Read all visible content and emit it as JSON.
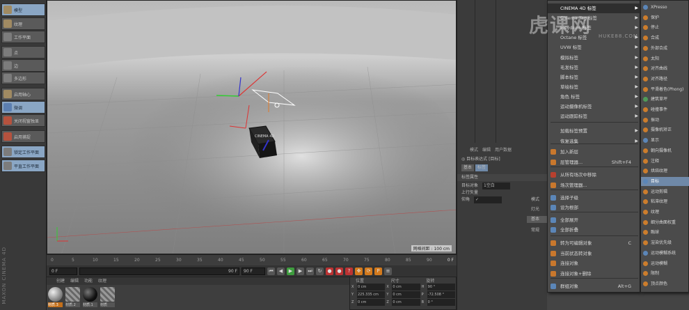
{
  "app": {
    "watermark": "虎课网",
    "watermark_url": "HUKE88.COM",
    "brand": "MAXON CINEMA 4D"
  },
  "toolbar": [
    {
      "label": "模型",
      "sel": true,
      "icon": "model-icon"
    },
    {
      "label": "纹理",
      "sel": false,
      "icon": "texture-icon"
    },
    {
      "label": "工作平面",
      "sel": false,
      "icon": "workplane-icon"
    },
    {
      "label": "点",
      "sel": false,
      "icon": "point-icon"
    },
    {
      "label": "边",
      "sel": false,
      "icon": "edge-icon"
    },
    {
      "label": "多边形",
      "sel": false,
      "icon": "polygon-icon"
    },
    {
      "label": "启用轴心",
      "sel": false,
      "icon": "axis-icon"
    },
    {
      "label": "微调",
      "sel": true,
      "icon": "tweak-icon"
    },
    {
      "label": "关闭视窗独显",
      "sel": false,
      "icon": "solo-icon"
    },
    {
      "label": "启用捕捉",
      "sel": false,
      "icon": "snap-icon"
    },
    {
      "label": "锁定工作平面",
      "sel": true,
      "icon": "lock-icon"
    },
    {
      "label": "平直工作平面",
      "sel": true,
      "icon": "plane-icon"
    }
  ],
  "viewport": {
    "status": "网格间距 : 100 cm",
    "cube_label": "CINEMA 4D"
  },
  "timeline": {
    "frames": [
      "0",
      "5",
      "10",
      "15",
      "20",
      "25",
      "30",
      "35",
      "40",
      "45",
      "50",
      "55",
      "60",
      "65",
      "70",
      "75",
      "80",
      "85",
      "90"
    ],
    "end": "0 F"
  },
  "playbar": {
    "start": "0 F",
    "range": "90 F",
    "end": "90 F"
  },
  "materials": {
    "tabs": [
      "创建",
      "编辑",
      "功能",
      "纹理"
    ],
    "items": [
      {
        "label": "材质.3",
        "sel": true
      },
      {
        "label": "材质.2",
        "sel": false
      },
      {
        "label": "材质.1",
        "sel": false
      },
      {
        "label": "材质",
        "sel": false
      }
    ]
  },
  "coords": {
    "head": [
      "位置",
      "尺寸",
      "旋转"
    ],
    "rows": [
      [
        "X",
        "0 cm",
        "X",
        "0 cm",
        "H",
        "90 °"
      ],
      [
        "Y",
        "225.335 cm",
        "Y",
        "0 cm",
        "P",
        "-72.508 °"
      ],
      [
        "Z",
        "0 cm",
        "Z",
        "0 cm",
        "B",
        "0 °"
      ]
    ]
  },
  "attr": {
    "tabs": [
      "模式",
      "编辑",
      "用户数据"
    ],
    "title": "目标表达式 [目标]",
    "buttons": [
      "基本",
      "标签"
    ],
    "section": "标签属性",
    "fields": [
      {
        "label": "目标对象",
        "value": "1空白"
      },
      {
        "label": "上行矢量",
        "value": ""
      },
      {
        "label": "仰角",
        "value": "✓"
      }
    ],
    "lower": {
      "mode": "模式",
      "light": "灯光",
      "basic": "基本",
      "common": "常规"
    }
  },
  "menu": [
    {
      "label": "CINEMA 4D 标签",
      "arrow": true,
      "hl": true,
      "icon": ""
    },
    {
      "label": "Cinema Tag 标签",
      "arrow": true,
      "icon": ""
    },
    {
      "label": "Insydium 标签",
      "arrow": true,
      "icon": ""
    },
    {
      "label": "Octane 标签",
      "arrow": true,
      "icon": ""
    },
    {
      "label": "UVW 标签",
      "arrow": true,
      "icon": ""
    },
    {
      "label": "模拟标签",
      "arrow": true,
      "icon": ""
    },
    {
      "label": "毛发标签",
      "arrow": true,
      "icon": ""
    },
    {
      "label": "脚本标签",
      "arrow": true,
      "icon": ""
    },
    {
      "label": "草绘标签",
      "arrow": true,
      "icon": ""
    },
    {
      "label": "角色 标签",
      "arrow": true,
      "icon": ""
    },
    {
      "label": "运动摄像机标签",
      "arrow": true,
      "icon": ""
    },
    {
      "label": "运动跟踪标签",
      "arrow": true,
      "icon": ""
    },
    {
      "label": "加载标签预置",
      "arrow": true,
      "icon": ""
    },
    {
      "label": "恢复选集",
      "arrow": true,
      "icon": ""
    },
    {
      "label": "加入新层",
      "icon": "o"
    },
    {
      "label": "层管理器...",
      "shortcut": "Shift+F4",
      "icon": "o"
    },
    {
      "label": "从所有场次中移除",
      "icon": "r"
    },
    {
      "label": "场次管理器...",
      "icon": "o"
    },
    {
      "label": "选择子级",
      "icon": "b"
    },
    {
      "label": "设为根部",
      "icon": "b"
    },
    {
      "label": "全部展开",
      "icon": "b"
    },
    {
      "label": "全部折叠",
      "icon": "b"
    },
    {
      "label": "转为可编辑对象",
      "shortcut": "C",
      "icon": "o"
    },
    {
      "label": "当前状态转对象",
      "icon": "o"
    },
    {
      "label": "连接对象",
      "icon": "o"
    },
    {
      "label": "连接对象+删除",
      "icon": "o"
    },
    {
      "label": "群组对象",
      "shortcut": "Alt+G",
      "icon": "b"
    }
  ],
  "submenu": [
    {
      "label": "XPresso",
      "icon": "b"
    },
    {
      "label": "保护",
      "icon": "o"
    },
    {
      "label": "停止",
      "icon": "o"
    },
    {
      "label": "合成",
      "icon": "o"
    },
    {
      "label": "外部合成",
      "icon": "o"
    },
    {
      "label": "太阳",
      "icon": "o"
    },
    {
      "label": "对齐曲线",
      "icon": "o"
    },
    {
      "label": "对齐路径",
      "icon": "o"
    },
    {
      "label": "平滑着色(Phong)",
      "icon": "o"
    },
    {
      "label": "建筑草坪",
      "icon": "g"
    },
    {
      "label": "碰撞事件",
      "icon": "o"
    },
    {
      "label": "振动",
      "icon": "o"
    },
    {
      "label": "摄像机矫正",
      "icon": "o"
    },
    {
      "label": "显示",
      "icon": "b"
    },
    {
      "label": "朝向摄像机",
      "icon": "o"
    },
    {
      "label": "注释",
      "icon": "o"
    },
    {
      "label": "烘焙纹理",
      "icon": "o"
    },
    {
      "label": "目标",
      "icon": "b",
      "hl": true
    },
    {
      "label": "运动剪辑",
      "icon": "o"
    },
    {
      "label": "粘滞纹理",
      "icon": "o"
    },
    {
      "label": "纹理",
      "icon": "o"
    },
    {
      "label": "细分曲面权重",
      "icon": "o"
    },
    {
      "label": "融球",
      "icon": "o"
    },
    {
      "label": "渲染优先级",
      "icon": "o"
    },
    {
      "label": "运动模糊系统",
      "icon": "b"
    },
    {
      "label": "运动模糊",
      "icon": "o"
    },
    {
      "label": "限制",
      "icon": "o"
    },
    {
      "label": "顶点颜色",
      "icon": "o"
    }
  ]
}
